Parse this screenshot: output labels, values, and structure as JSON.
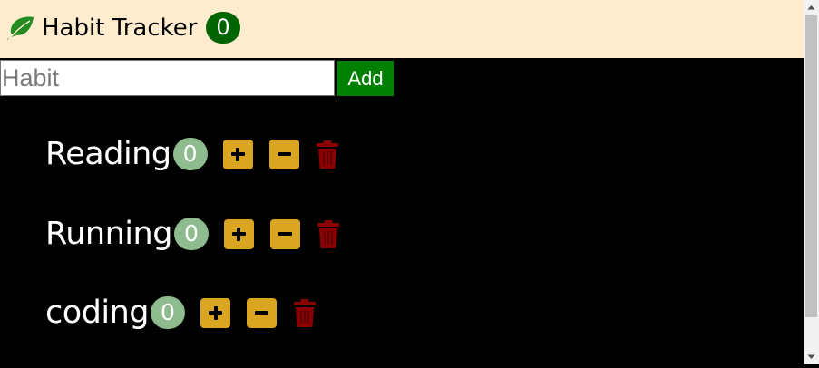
{
  "header": {
    "title": "Habit Tracker",
    "total_count": "0",
    "icon": "leaf-icon",
    "background_color": "#ffebcd",
    "count_badge_color": "#006400",
    "icon_color": "#228b22"
  },
  "form": {
    "input_value": "",
    "input_placeholder": "Habit",
    "add_label": "Add",
    "add_button_color": "#008000"
  },
  "habits": [
    {
      "name": "Reading",
      "count": "0"
    },
    {
      "name": "Running",
      "count": "0"
    },
    {
      "name": "coding",
      "count": "0"
    }
  ],
  "controls": {
    "increment_icon": "plus-icon",
    "decrement_icon": "minus-icon",
    "delete_icon": "trash-icon",
    "button_color": "#daa520",
    "delete_color": "#8b0000",
    "count_badge_color": "#8fbc8f"
  },
  "theme": {
    "background": "#000000",
    "text": "#ffffff"
  }
}
